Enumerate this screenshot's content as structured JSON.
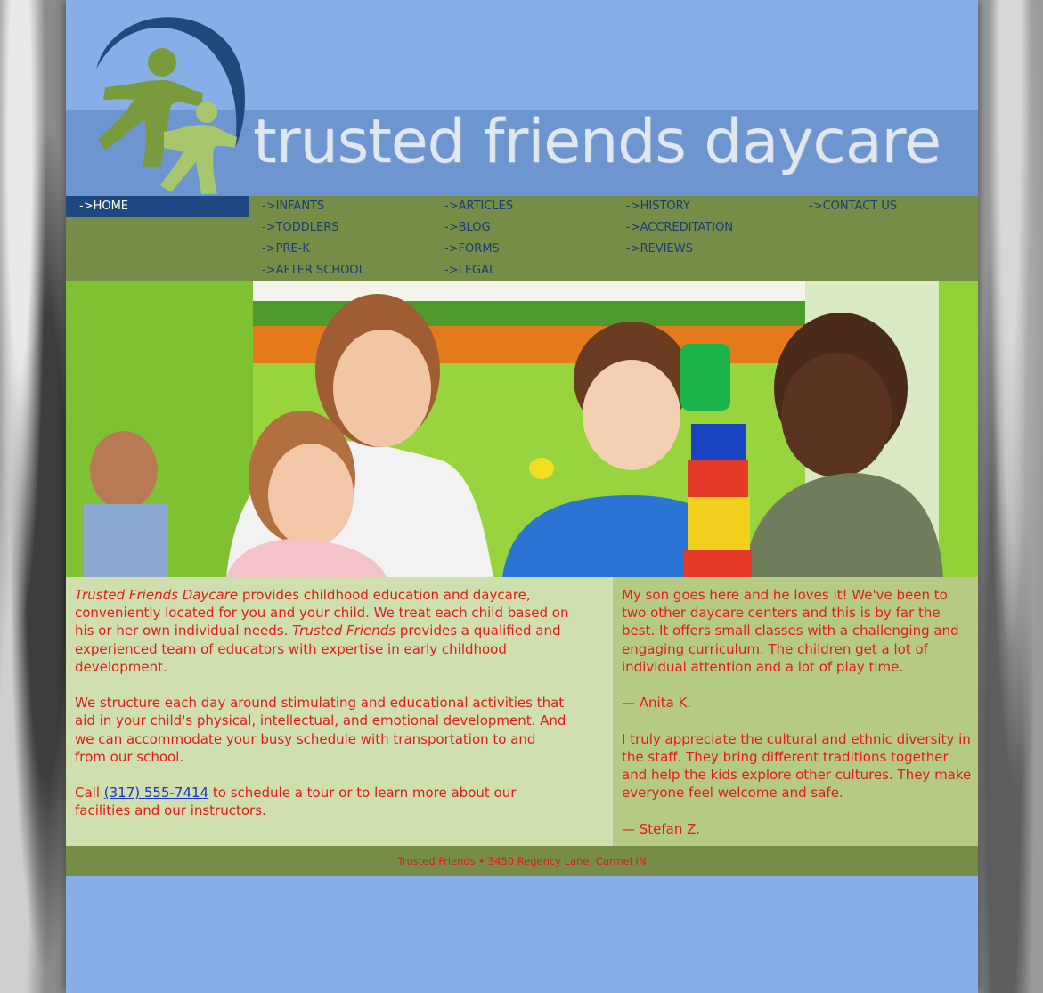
{
  "brand": {
    "name": "trusted friends daycare"
  },
  "nav": {
    "items": [
      {
        "label": "->HOME"
      },
      {
        "label": "->INFANTS"
      },
      {
        "label": "->TODDLERS"
      },
      {
        "label": "->PRE-K"
      },
      {
        "label": "->AFTER SCHOOL"
      },
      {
        "label": "->ARTICLES"
      },
      {
        "label": "->BLOG"
      },
      {
        "label": "->FORMS"
      },
      {
        "label": "->LEGAL"
      },
      {
        "label": "->HISTORY"
      },
      {
        "label": "->ACCREDITATION"
      },
      {
        "label": "->REVIEWS"
      },
      {
        "label": "->CONTACT US"
      }
    ]
  },
  "intro": {
    "p1_em1": "Trusted Friends Daycare",
    "p1_a": " provides childhood education and daycare, conveniently located for you and your child. We treat each child based on his or her own individual needs. ",
    "p1_em2": "Trusted Friends",
    "p1_b": " provides a qualified and experienced team of educators with expertise in early childhood development.",
    "p2": "We structure each day around stimulating and educational activities that aid in your child's physical, intellectual, and emotional development. And we can accommodate your busy schedule with transportation to and from our school.",
    "p3_a": "Call ",
    "phone": "(317) 555-7414",
    "p3_b": " to schedule a tour or to learn more about our facilities and our instructors."
  },
  "reviews": [
    {
      "text": "My son goes here and he loves it! We've been to two other daycare centers and this is by far the best. It offers small classes with a challenging and engaging curriculum. The children get a lot of individual attention and a lot of play time.",
      "author": "— Anita K."
    },
    {
      "text": "I truly appreciate the cultural and ethnic diversity in the staff. They bring different traditions together and help the kids explore other cultures. They make everyone feel welcome and safe.",
      "author": "— Stefan Z."
    }
  ],
  "footer": {
    "text": "Trusted Friends • 3450 Regency Lane, Carmel IN"
  },
  "colors": {
    "page_bg": "#87aee6",
    "nav_bg": "#758d46",
    "nav_active": "#1f4782",
    "text_red": "#e31a1a",
    "content_left": "#cfdfad",
    "content_right": "#b5cb84"
  }
}
